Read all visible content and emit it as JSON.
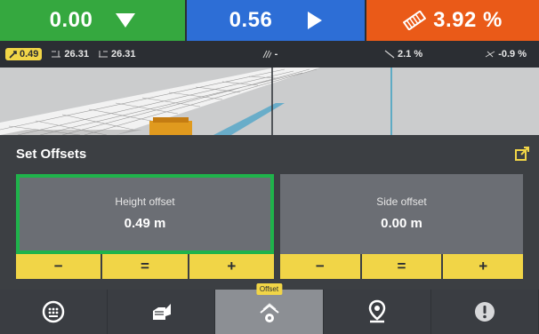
{
  "topbar": {
    "cut_fill": {
      "value": "0.00",
      "color": "#35a83f",
      "sub": {
        "offset_badge": "0.49",
        "left_value": "26.31",
        "right_value": "26.31"
      }
    },
    "side": {
      "value": "0.56",
      "color": "#2d6ed6",
      "sub": {
        "slope_value": "-"
      }
    },
    "slope": {
      "value": "3.92 %",
      "color": "#ea5a18",
      "sub": {
        "cross_slope": "2.1 %",
        "main_slope": "-0.9 %"
      }
    }
  },
  "panel": {
    "title": "Set Offsets",
    "height_offset": {
      "label": "Height offset",
      "value": "0.49 m",
      "minus": "−",
      "equal": "=",
      "plus": "+"
    },
    "side_offset": {
      "label": "Side offset",
      "value": "0.00 m",
      "minus": "−",
      "equal": "=",
      "plus": "+"
    }
  },
  "bottombar": {
    "items": [
      {
        "icon": "keypad-icon"
      },
      {
        "icon": "machine-bucket-icon"
      },
      {
        "icon": "offset-icon",
        "tooltip": "Offset",
        "active": true
      },
      {
        "icon": "map-pin-icon"
      },
      {
        "icon": "alert-icon"
      }
    ]
  },
  "colors": {
    "accent_yellow": "#f1d547",
    "selected_green": "#1fb34b"
  }
}
